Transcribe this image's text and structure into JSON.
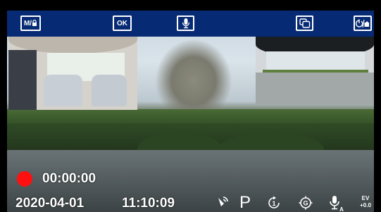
{
  "toolbar": {
    "mode_lock_label": "M/",
    "ok_label": "OK"
  },
  "recording": {
    "elapsed": "00:00:00",
    "indicator_color": "#ff1010"
  },
  "timestamp": {
    "date": "2020-04-01",
    "time": "11:10:09"
  },
  "status": {
    "gps_mark": "G",
    "parking_mark": "P",
    "ev_label": "EV",
    "ev_value": "+0.0"
  },
  "icons": [
    "mode-lock-icon",
    "mic-icon",
    "pip-switch-icon",
    "camera-switch-icon",
    "signal-icon",
    "parking-icon",
    "loop-record-icon",
    "gps-icon",
    "mic-auto-icon"
  ],
  "colors": {
    "toolbar_bg": "#062a73",
    "text": "#ffffff",
    "record": "#ff1010"
  }
}
